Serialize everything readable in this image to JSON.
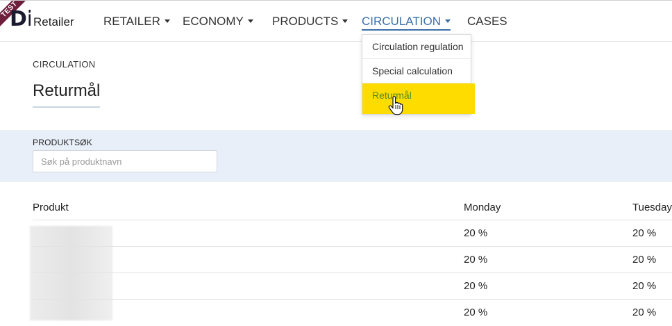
{
  "header": {
    "logo_ribbon": "TEST",
    "logo_mark": "Di",
    "brand": "Retailer",
    "nav": [
      {
        "label": "RETAILER",
        "has_caret": true
      },
      {
        "label": "ECONOMY",
        "has_caret": true
      },
      {
        "label": "PRODUCTS",
        "has_caret": true
      },
      {
        "label": "CIRCULATION",
        "has_caret": true,
        "active": true
      },
      {
        "label": "CASES",
        "has_caret": false
      }
    ]
  },
  "dropdown": {
    "items": [
      {
        "label": "Circulation regulation"
      },
      {
        "label": "Special calculation"
      },
      {
        "label": "Returmål",
        "highlighted": true
      }
    ]
  },
  "page": {
    "section": "CIRCULATION",
    "title": "Returmål"
  },
  "search": {
    "label": "PRODUKTSØK",
    "placeholder": "Søk på produktnavn",
    "value": ""
  },
  "table": {
    "columns": [
      "Produkt",
      "Monday",
      "Tuesday"
    ],
    "rows": [
      {
        "product": "",
        "monday": "20 %",
        "tuesday": "20 %"
      },
      {
        "product": "",
        "monday": "20 %",
        "tuesday": "20 %"
      },
      {
        "product": "",
        "monday": "20 %",
        "tuesday": "20 %"
      },
      {
        "product": "",
        "monday": "20 %",
        "tuesday": "20 %"
      }
    ]
  },
  "colors": {
    "accent": "#3b6ea8",
    "highlight": "#ffdc00",
    "highlight_text": "#4a8a2c",
    "band": "#e8eff8",
    "ribbon": "#6d1f3b"
  },
  "icons": {
    "cursor": "hand-pointer-icon",
    "caret": "caret-down-icon"
  }
}
